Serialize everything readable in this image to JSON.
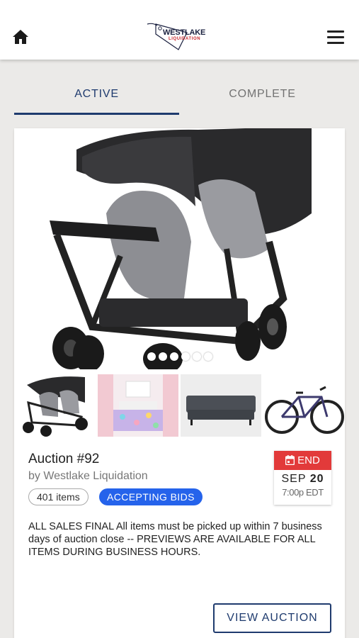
{
  "header": {
    "logo_text": "WESTLAKE",
    "logo_subtext": "LIQUIDATION",
    "home_icon": "home-icon",
    "menu_icon": "hamburger-menu-icon"
  },
  "tabs": [
    {
      "label": "ACTIVE",
      "active": true
    },
    {
      "label": "COMPLETE",
      "active": false
    }
  ],
  "auction": {
    "title": "Auction #92",
    "seller": "by Westlake Liquidation",
    "items_count": "401 items",
    "status": "ACCEPTING BIDS",
    "end_label": "END",
    "end_month": "SEP",
    "end_day": "20",
    "end_time": "7:00p EDT",
    "description": "ALL SALES FINAL All items must be picked up within 7 business days of auction close -- PREVIEWS ARE AVAILABLE FOR ALL ITEMS DURING BUSINESS HOURS.",
    "view_button": "VIEW AUCTION",
    "carousel_dots": 6,
    "thumbnails": [
      "double-stroller-thumbnail",
      "kids-bedding-thumbnail",
      "gray-sofa-thumbnail",
      "bicycle-thumbnail"
    ]
  },
  "colors": {
    "brand_navy": "#1f3b6e",
    "status_blue": "#2563eb",
    "end_red": "#e23a3a",
    "background": "#ebeae8"
  }
}
